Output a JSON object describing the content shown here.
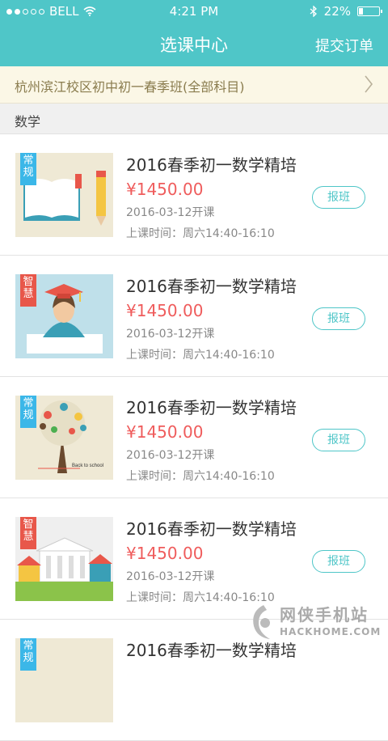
{
  "status_bar": {
    "carrier": "BELL",
    "time": "4:21 PM",
    "battery": "22%",
    "battery_level": 0.22,
    "signal_bars": 2,
    "signal_total": 5
  },
  "nav": {
    "title": "选课中心",
    "action": "提交订单"
  },
  "campus": {
    "label": "杭州滨江校区初中初一春季班(全部科目)"
  },
  "section": {
    "title": "数学"
  },
  "courses": [
    {
      "tag": "常规",
      "tag_color": "#3bb7e8",
      "title": "2016春季初一数学精培",
      "price": "¥1450.00",
      "date": "2016-03-12开课",
      "schedule": "上课时间：周六14:40-16:10",
      "button": "报班",
      "thumb_icon": "book-pencil-illustration"
    },
    {
      "tag": "智慧",
      "tag_color": "#e8574a",
      "title": "2016春季初一数学精培",
      "price": "¥1450.00",
      "date": "2016-03-12开课",
      "schedule": "上课时间：周六14:40-16:10",
      "button": "报班",
      "thumb_icon": "graduate-illustration"
    },
    {
      "tag": "常规",
      "tag_color": "#3bb7e8",
      "title": "2016春季初一数学精培",
      "price": "¥1450.00",
      "date": "2016-03-12开课",
      "schedule": "上课时间：周六14:40-16:10",
      "button": "报班",
      "thumb_icon": "knowledge-tree-illustration",
      "thumb_caption": "Back to school"
    },
    {
      "tag": "智慧",
      "tag_color": "#e8574a",
      "title": "2016春季初一数学精培",
      "price": "¥1450.00",
      "date": "2016-03-12开课",
      "schedule": "上课时间：周六14:40-16:10",
      "button": "报班",
      "thumb_icon": "school-building-illustration"
    },
    {
      "tag": "常规",
      "tag_color": "#3bb7e8",
      "title": "2016春季初一数学精培",
      "price": "",
      "date": "",
      "schedule": "",
      "button": "",
      "thumb_icon": "book-pencil-illustration"
    }
  ],
  "watermark": {
    "cn": "网侠手机站",
    "en": "HACKHOME.COM"
  },
  "colors": {
    "accent": "#4fc6c8",
    "price": "#ef5c5c",
    "banner_bg": "#fbf7e6"
  }
}
